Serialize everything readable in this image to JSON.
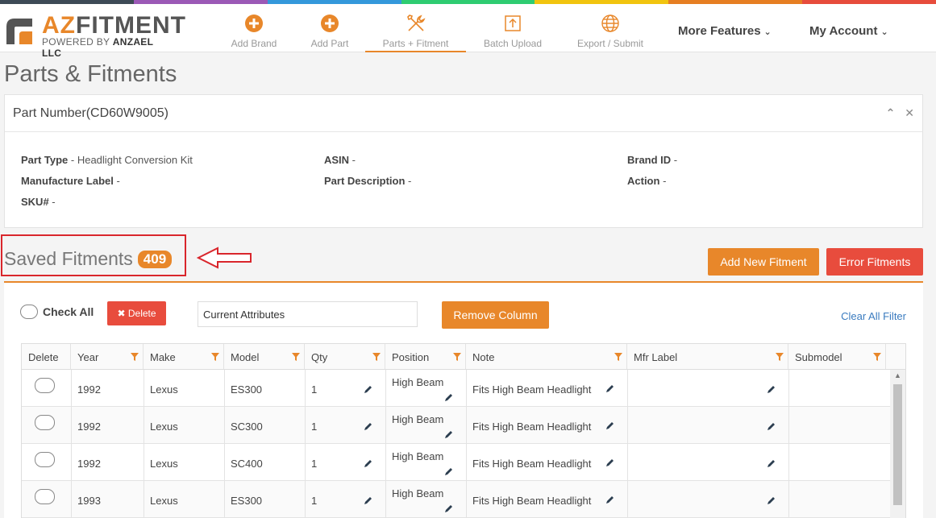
{
  "colors": {
    "accent": "#e8872a",
    "danger": "#e84c3d",
    "link": "#3a7bbf",
    "stripes": [
      "#3d4a56",
      "#9b59b6",
      "#3498db",
      "#2ecc71",
      "#f1c40f",
      "#e67e22",
      "#e74c3c"
    ]
  },
  "logo": {
    "brand_a": "AZ",
    "brand_b": "FITMENT",
    "powered": "POWERED BY ",
    "company": "ANZAEL LLC"
  },
  "nav": {
    "items": [
      {
        "label": "Add Brand",
        "icon": "plus-circle-icon"
      },
      {
        "label": "Add Part",
        "icon": "plus-circle-icon"
      },
      {
        "label": "Parts + Fitment",
        "icon": "tools-icon"
      },
      {
        "label": "Batch Upload",
        "icon": "upload-icon"
      },
      {
        "label": "Export / Submit",
        "icon": "globe-icon"
      }
    ],
    "more_features": "More Features",
    "my_account": "My Account"
  },
  "page": {
    "title": "Parts & Fitments"
  },
  "part": {
    "header": "Part Number(CD60W9005)",
    "fields": {
      "part_type_label": "Part Type",
      "part_type_value": " - Headlight Conversion Kit",
      "mfr_label": "Manufacture Label",
      "mfr_value": " -",
      "sku_label": "SKU#",
      "sku_value": " -",
      "asin_label": "ASIN",
      "asin_value": " -",
      "desc_label": "Part Description",
      "desc_value": " -",
      "brand_label": "Brand ID",
      "brand_value": " -",
      "action_label": "Action",
      "action_value": " -"
    }
  },
  "saved": {
    "title": "Saved Fitments",
    "count": "409"
  },
  "buttons": {
    "add_new": "Add New Fitment",
    "error": "Error Fitments",
    "check_all": "Check All",
    "delete": "Delete",
    "remove_column": "Remove Column",
    "clear_filter": "Clear All Filter"
  },
  "attributes_input": {
    "value": "Current Attributes"
  },
  "table": {
    "columns": [
      "Delete",
      "Year",
      "Make",
      "Model",
      "Qty",
      "Position",
      "Note",
      "Mfr Label",
      "Submodel"
    ],
    "rows": [
      {
        "year": "1992",
        "make": "Lexus",
        "model": "ES300",
        "qty": "1",
        "position": "High Beam",
        "note": "Fits High Beam Headlight",
        "mfr": "",
        "submodel": ""
      },
      {
        "year": "1992",
        "make": "Lexus",
        "model": "SC300",
        "qty": "1",
        "position": "High Beam",
        "note": "Fits High Beam Headlight",
        "mfr": "",
        "submodel": ""
      },
      {
        "year": "1992",
        "make": "Lexus",
        "model": "SC400",
        "qty": "1",
        "position": "High Beam",
        "note": "Fits High Beam Headlight",
        "mfr": "",
        "submodel": ""
      },
      {
        "year": "1993",
        "make": "Lexus",
        "model": "ES300",
        "qty": "1",
        "position": "High Beam",
        "note": "Fits High Beam Headlight",
        "mfr": "",
        "submodel": ""
      }
    ]
  }
}
